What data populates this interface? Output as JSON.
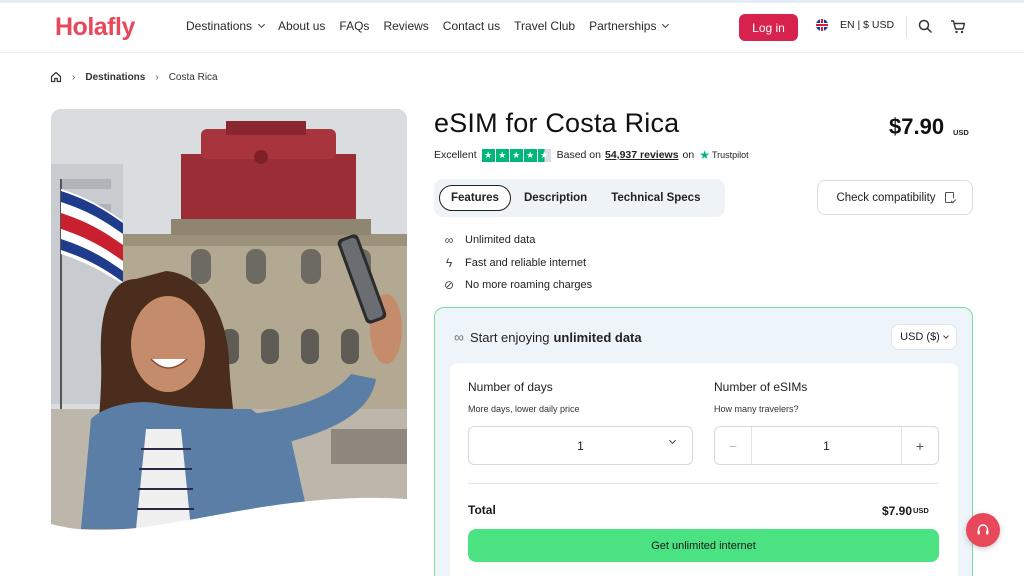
{
  "brand": {
    "logo": "Holafly",
    "accent": "#d8224e",
    "cta_color": "#4be282"
  },
  "nav": {
    "items": [
      {
        "label": "Destinations",
        "dropdown": true
      },
      {
        "label": "About us",
        "dropdown": false
      },
      {
        "label": "FAQs",
        "dropdown": false
      },
      {
        "label": "Reviews",
        "dropdown": false
      },
      {
        "label": "Contact us",
        "dropdown": false
      },
      {
        "label": "Travel Club",
        "dropdown": false
      },
      {
        "label": "Partnerships",
        "dropdown": true
      }
    ],
    "login_label": "Log in",
    "language_label": "EN | $ USD",
    "icons": [
      "uk-flag-icon",
      "search-icon",
      "cart-icon"
    ]
  },
  "breadcrumb": {
    "home_icon": "home-icon",
    "items": [
      "Destinations",
      "Costa Rica"
    ]
  },
  "product": {
    "title": "eSIM for Costa Rica",
    "price": "$7.90",
    "price_currency": "USD",
    "rating": {
      "label": "Excellent",
      "stars": 4.5,
      "based_on": "Based on",
      "reviews": "54,937 reviews",
      "on": "on",
      "provider": "Trustpilot"
    },
    "tabs": [
      "Features",
      "Description",
      "Technical Specs"
    ],
    "active_tab": "Features",
    "check_compat_label": "Check compatibility",
    "features": [
      {
        "icon": "infinity-icon",
        "label": "Unlimited data"
      },
      {
        "icon": "lightning-icon",
        "label": "Fast and reliable internet"
      },
      {
        "icon": "no-roaming-icon",
        "label": "No more roaming charges"
      }
    ]
  },
  "config": {
    "headline_prefix": "Start enjoying",
    "headline_bold": "unlimited data",
    "currency": "USD ($)",
    "days": {
      "label": "Number of days",
      "sub": "More days, lower daily price",
      "value": "1"
    },
    "esims": {
      "label": "Number of eSIMs",
      "sub": "How many travelers?",
      "value": "1",
      "minus": "−",
      "plus": "+"
    },
    "total_label": "Total",
    "total_value": "$7.90",
    "total_currency": "USD",
    "cta_label": "Get unlimited internet"
  }
}
